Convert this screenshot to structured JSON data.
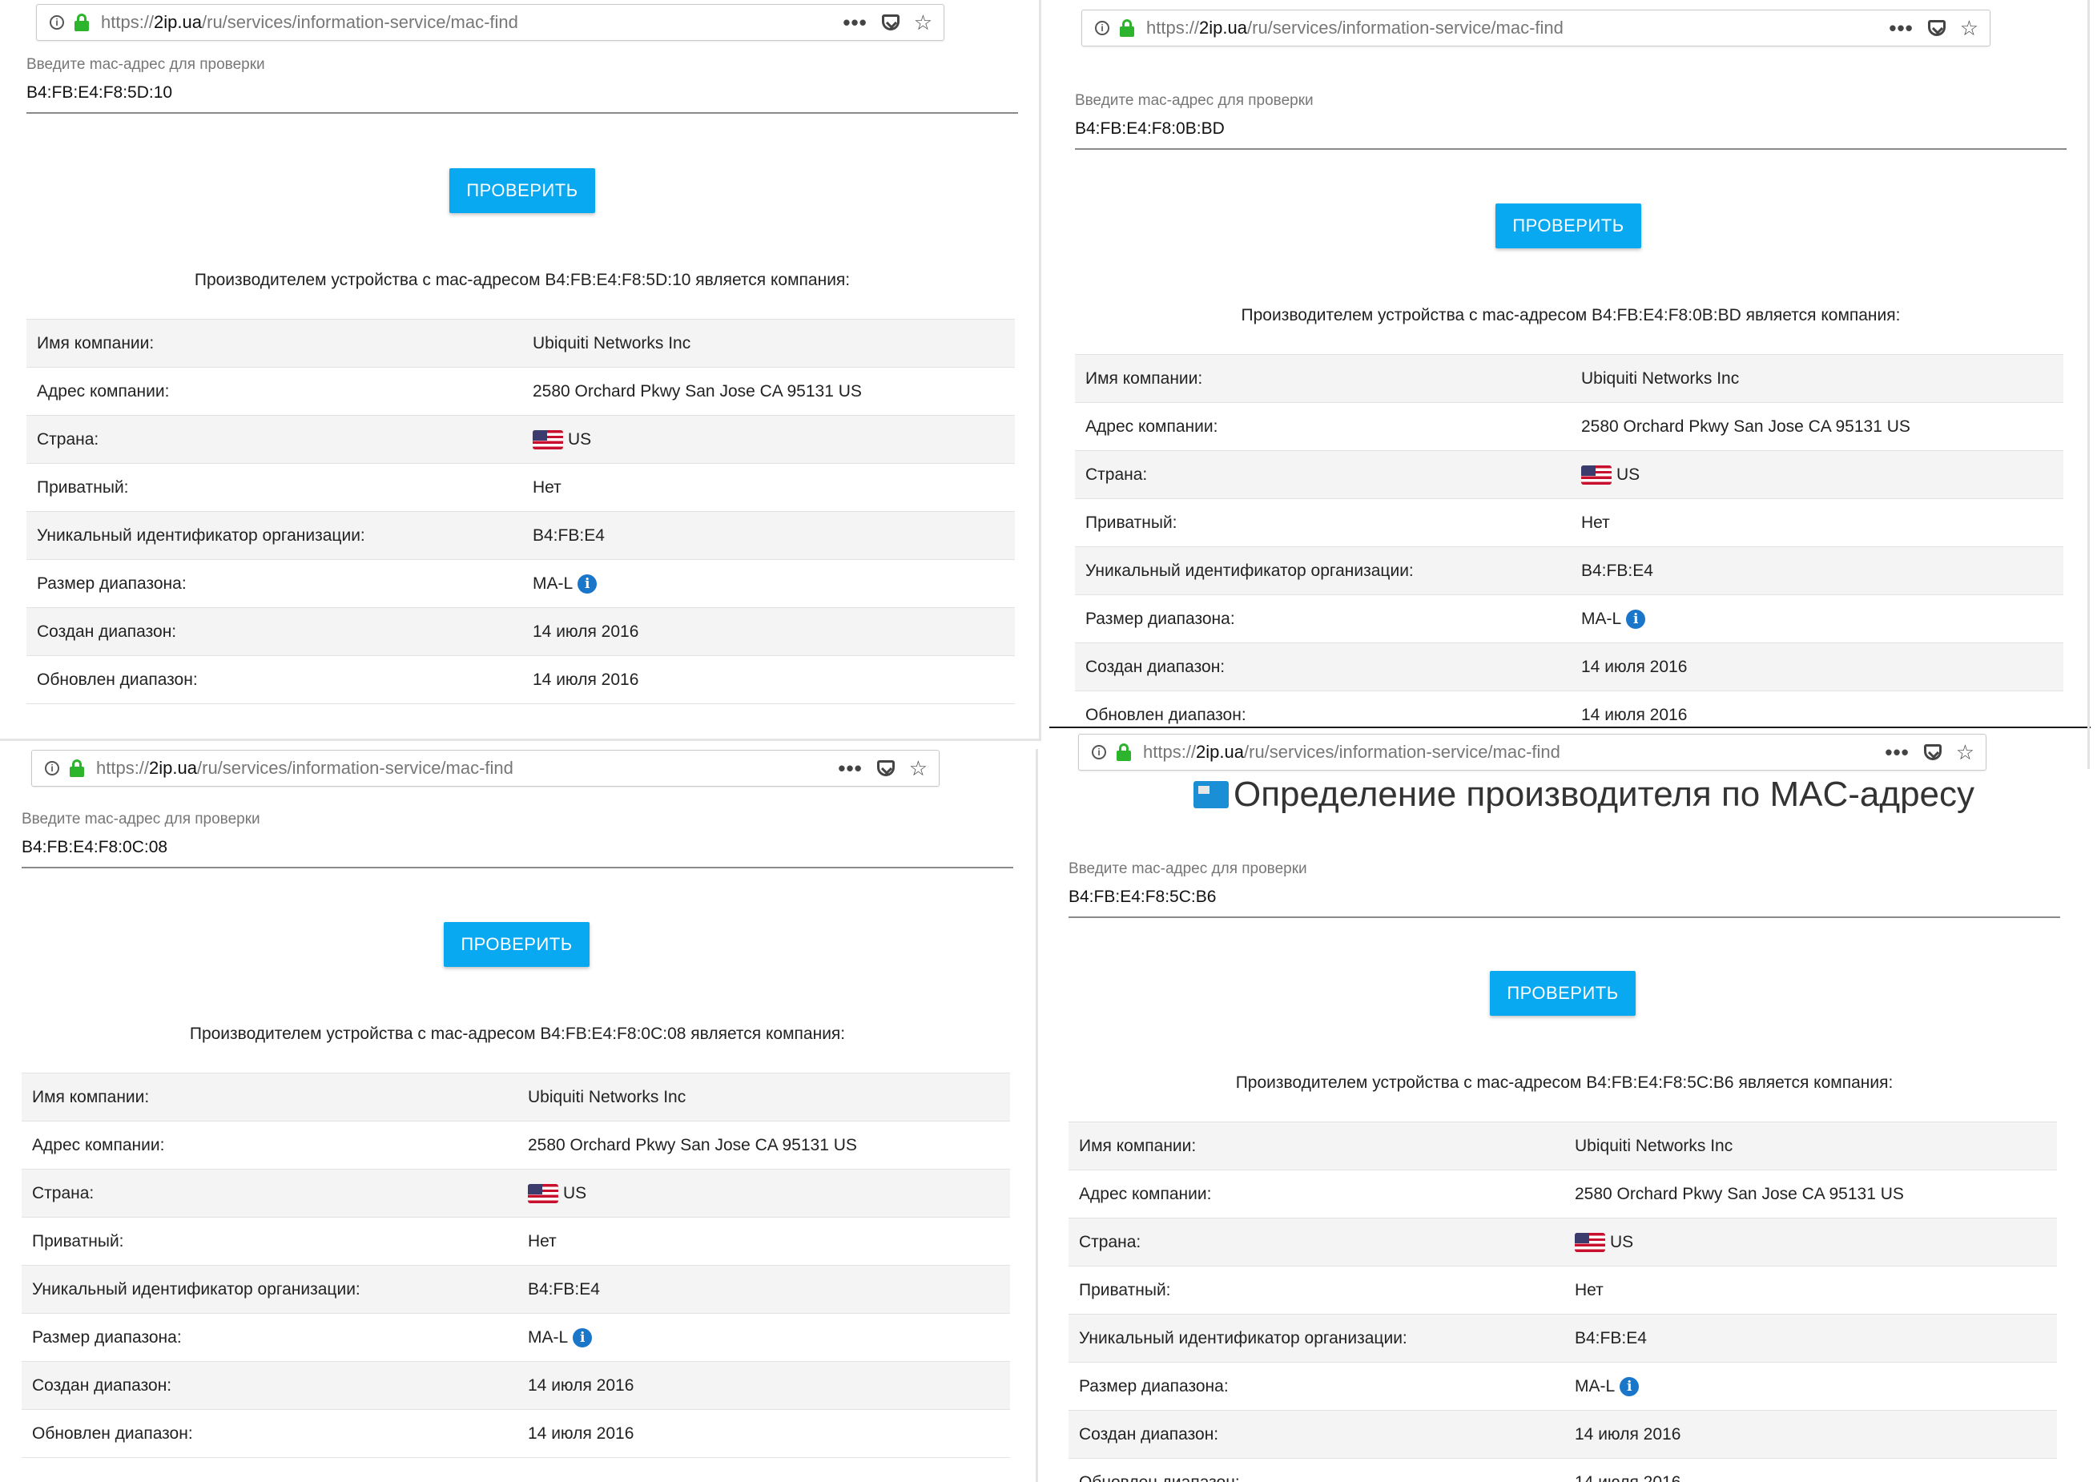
{
  "browser": {
    "url_prefix": "https://",
    "url_host": "2ip.ua",
    "url_path": "/ru/services/information-service/mac-find",
    "menu_dots": "•••",
    "star": "☆"
  },
  "form": {
    "label": "Введите mac-адрес для проверки",
    "button": "ПРОВЕРИТЬ"
  },
  "page_title": "Определение производителя по MAC-адресу",
  "panels": [
    {
      "mac": "B4:FB:E4:F8:5D:10",
      "result": "Производителем устройства с mac-адресом B4:FB:E4:F8:5D:10 является компания:"
    },
    {
      "mac": "B4:FB:E4:F8:0B:BD",
      "result": "Производителем устройства с mac-адресом B4:FB:E4:F8:0B:BD является компания:"
    },
    {
      "mac": "B4:FB:E4:F8:0C:08",
      "result": "Производителем устройства с mac-адресом B4:FB:E4:F8:0C:08 является компания:"
    },
    {
      "mac": "B4:FB:E4:F8:5C:B6",
      "result": "Производителем устройства с mac-адресом B4:FB:E4:F8:5C:B6 является компания:"
    }
  ],
  "table": {
    "labels": [
      "Имя компании:",
      "Адрес компании:",
      "Страна:",
      "Приватный:",
      "Уникальный идентификатор организации:",
      "Размер диапазона:",
      "Создан диапазон:",
      "Обновлен диапазон:"
    ],
    "values": {
      "company": "Ubiquiti Networks Inc",
      "address": "2580 Orchard Pkwy San Jose CA 95131 US",
      "country": "US",
      "private": "Нет",
      "oui": "B4:FB:E4",
      "range_size": "MA-L",
      "created": "14 июля 2016",
      "updated": "14 июля 2016"
    }
  },
  "colors": {
    "button": "#08a9f0",
    "lock": "#2db42d",
    "info_icon": "#1a76c9"
  },
  "icons": [
    "info-icon",
    "lock-icon",
    "more-icon",
    "pocket-icon",
    "star-icon",
    "us-flag-icon",
    "mac-lookup-icon"
  ]
}
